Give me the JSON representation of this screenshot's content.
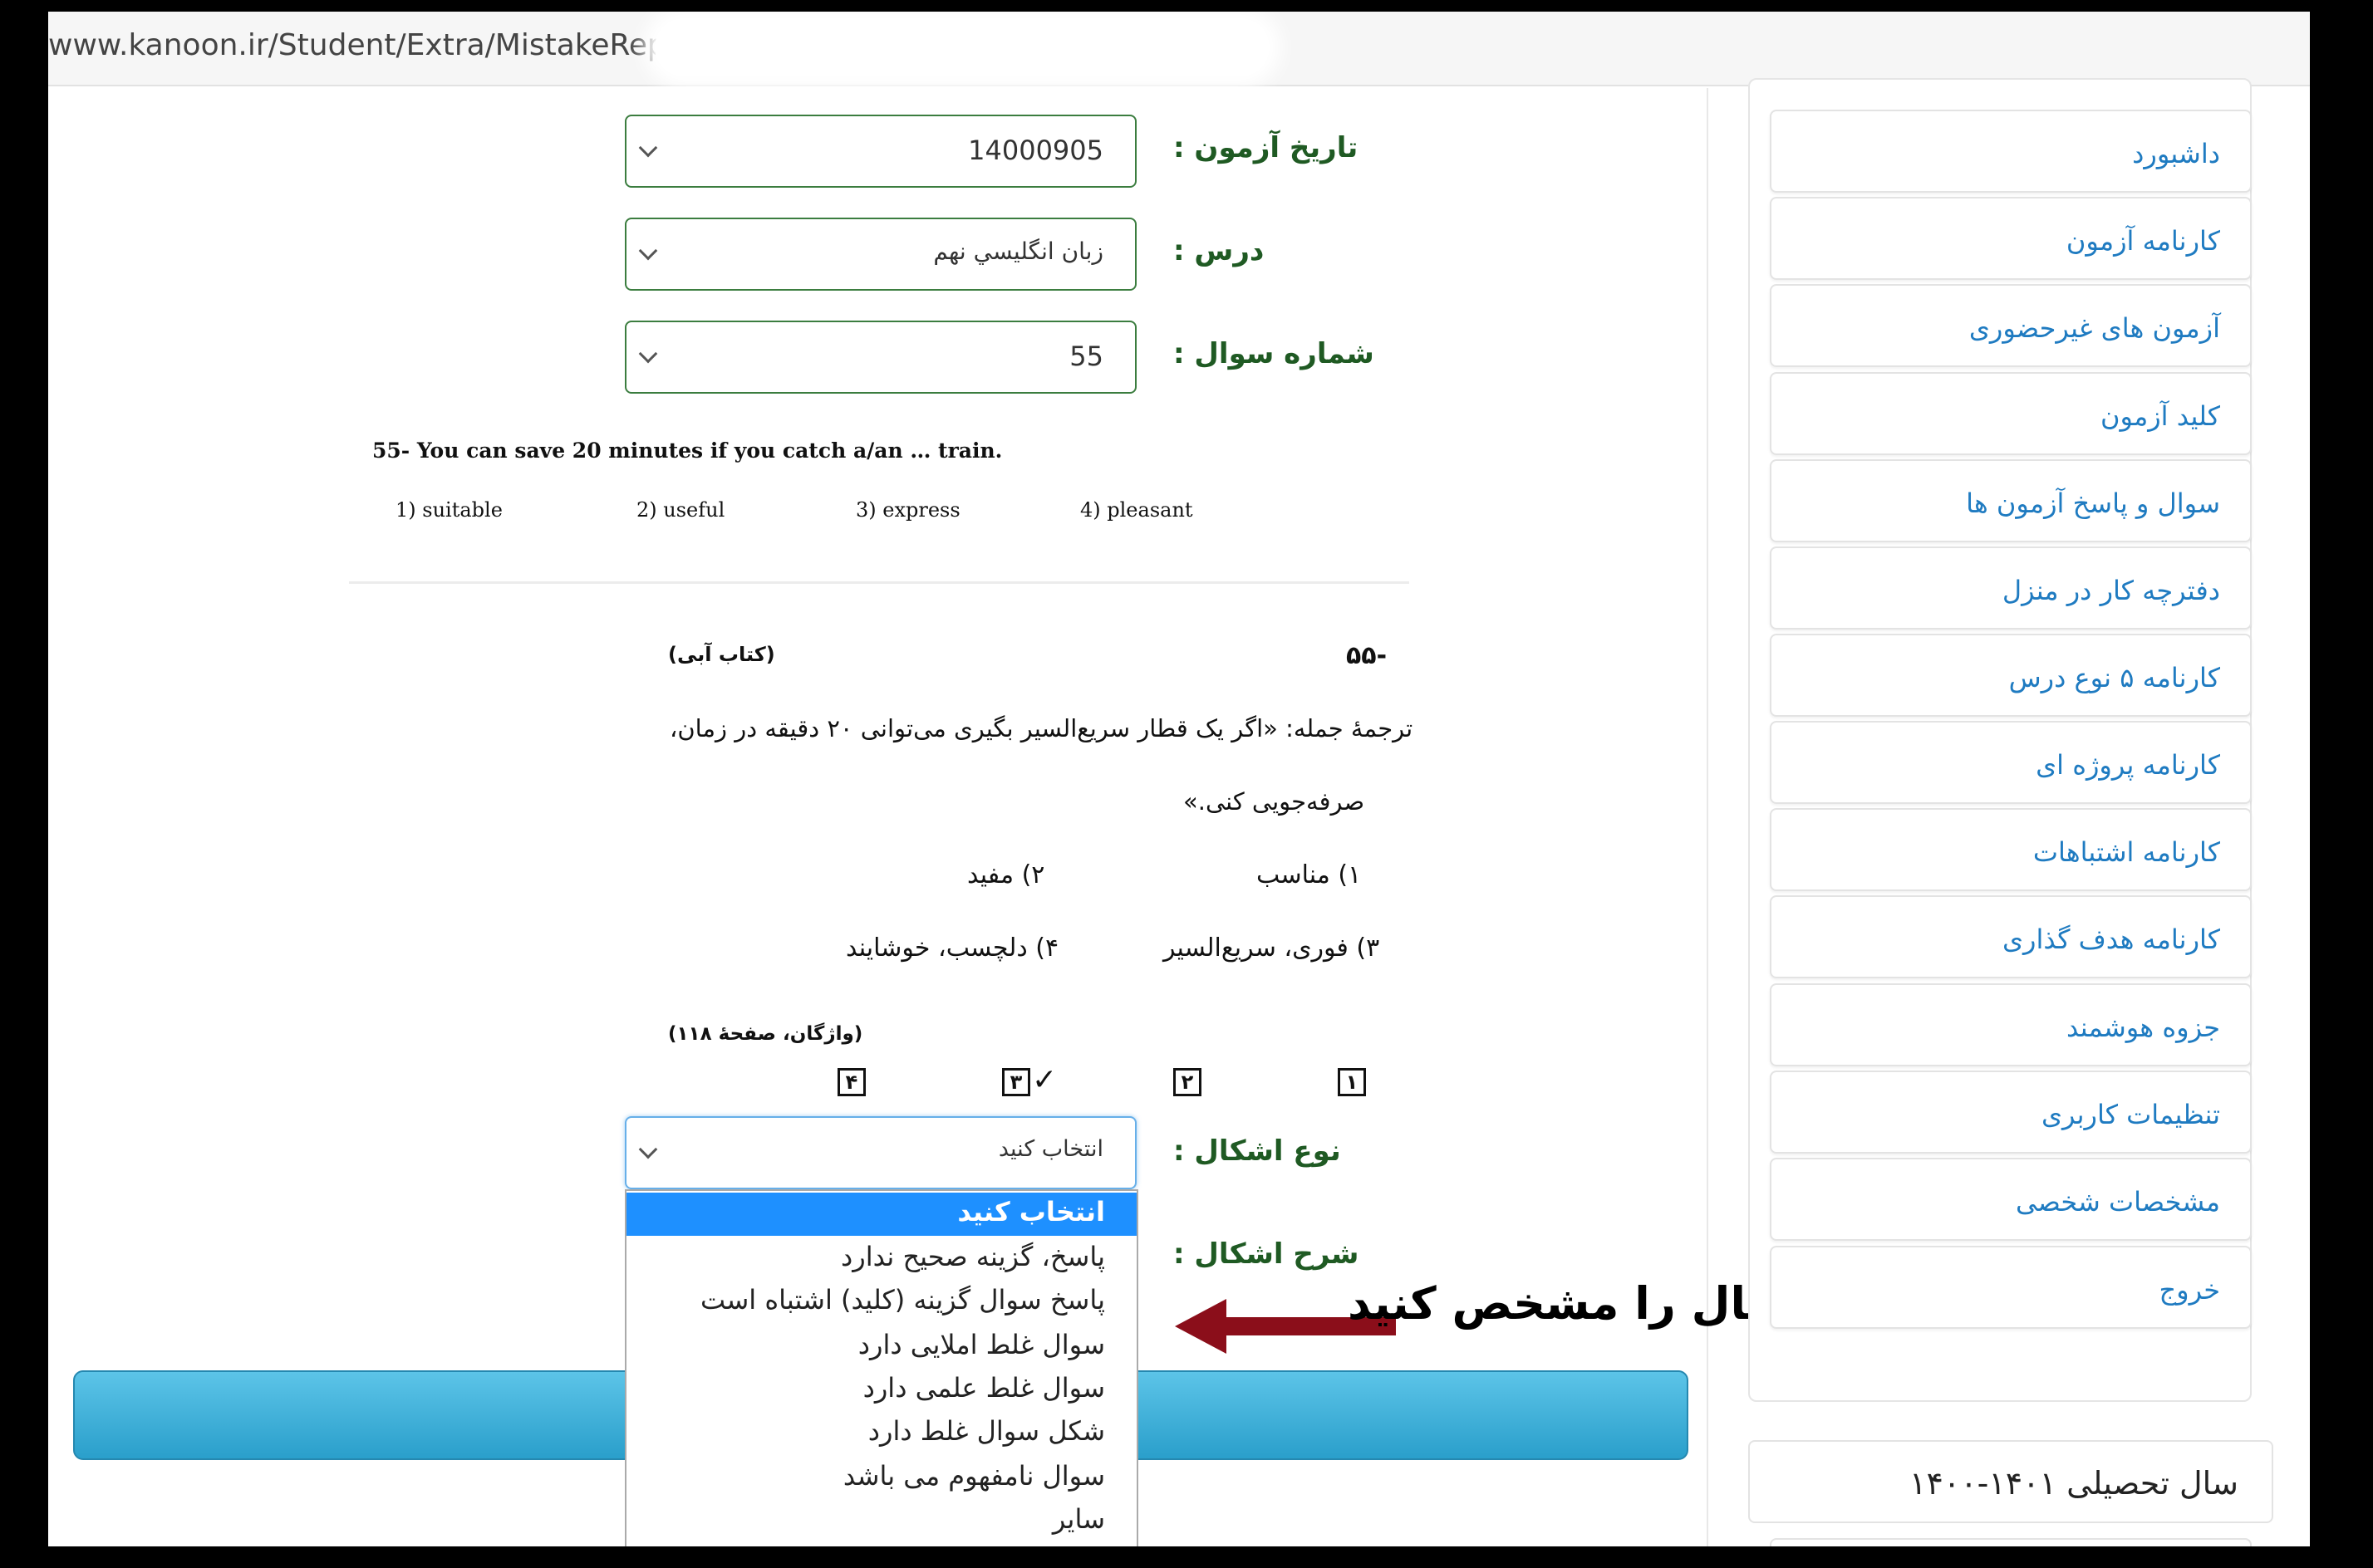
{
  "browser": {
    "url": "www.kanoon.ir/Student/Extra/MistakeReport"
  },
  "form": {
    "exam_date_label": "تاریخ آزمون :",
    "exam_date_value": "14000905",
    "subject_label": "درس :",
    "subject_value": "زبان انگليسي نهم",
    "question_no_label": "شماره سوال :",
    "question_no_value": "55",
    "mistake_type_label": "نوع اشکال :",
    "mistake_type_value": "انتخاب کنید",
    "mistake_desc_label": "شرح اشکال :"
  },
  "question": {
    "stem": "55-  You can save 20 minutes if you catch a/an … train.",
    "options": [
      "1) suitable",
      "2) useful",
      "3) express",
      "4) pleasant"
    ]
  },
  "answer": {
    "number": "-۵۵",
    "source": "(کتاب آبی)",
    "translation_line1": "ترجمهٔ جمله: «اگر یک قطار سریع‌السیر بگیری می‌توانی ۲۰ دقیقه در زمان،",
    "translation_line2": "صرفه‌جویی کنی.»",
    "opt1": "۱) مناسب",
    "opt2": "۲) مفید",
    "opt3": "۳) فوری، سریع‌السیر",
    "opt4": "۴) دلچسب، خوشایند",
    "reference": "(واژگان، صفحهٔ ۱۱۸)",
    "key_boxes": [
      "۱",
      "۲",
      "۳",
      "۴"
    ],
    "checkmark": "✓"
  },
  "dropdown": {
    "options": [
      "انتخاب کنید",
      "پاسخ، گزینه صحیح ندارد",
      "پاسخ سوال گزینه (کلید) اشتباه است",
      "سوال غلط املایی دارد",
      "سوال غلط علمی دارد",
      "شکل سوال غلط دارد",
      "سوال نامفهوم می باشد",
      "سایر"
    ],
    "selected_color": "#1e90ff"
  },
  "annotation": {
    "text": "نوع اشکال را مشخص کنید",
    "arrow_color": "#8b0e1a"
  },
  "sidebar": {
    "items": [
      "داشبورد",
      "کارنامه آزمون",
      "آزمون های غیرحضوری",
      "کلید آزمون",
      "سوال و پاسخ آزمون ها",
      "دفترچه کار در منزل",
      "کارنامه ۵ نوع درس",
      "کارنامه پروژه ای",
      "کارنامه اشتباهات",
      "کارنامه هدف گذاری",
      "جزوه هوشمند",
      "تنظیمات کاربری",
      "مشخصات شخصی",
      "خروج"
    ],
    "year": "سال تحصیلی ۱۴۰۱-۱۴۰۰",
    "link_color": "#1f7bc1"
  }
}
